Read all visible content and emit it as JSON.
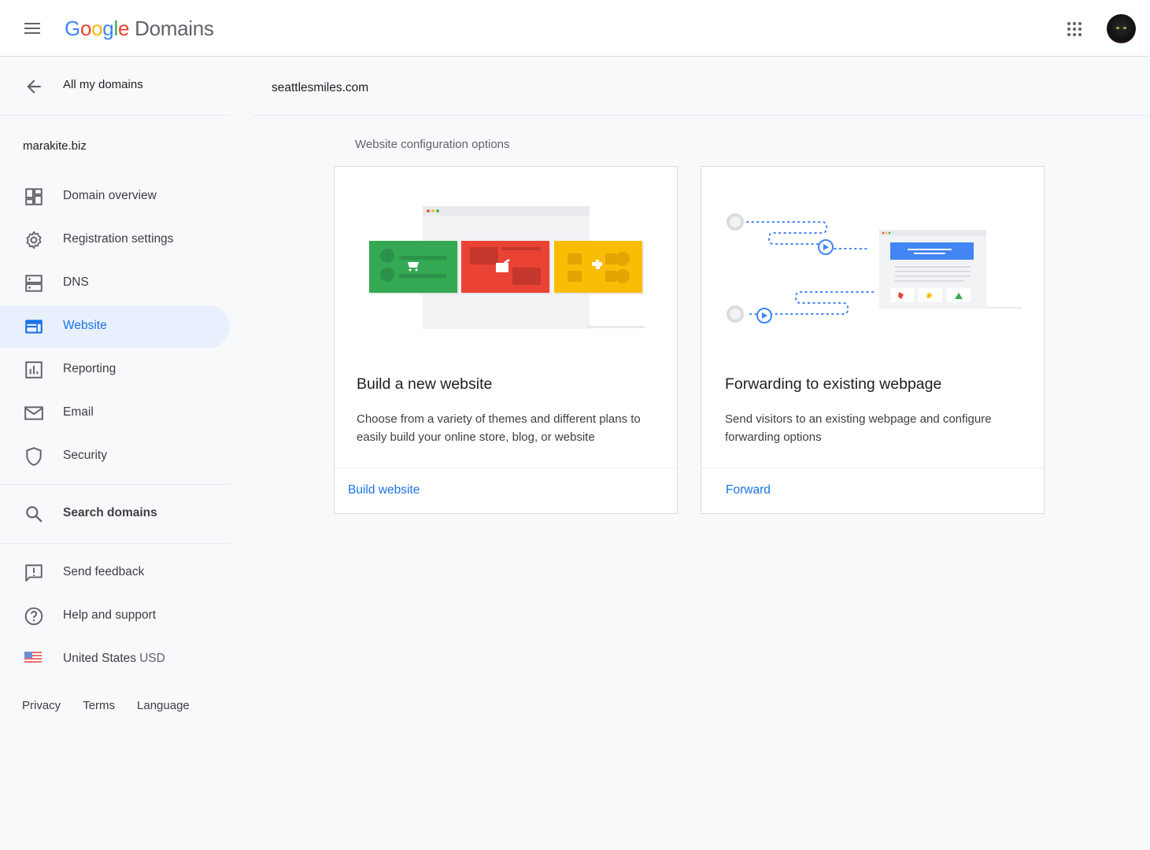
{
  "header": {
    "logo": {
      "g1": "G",
      "g2": "o",
      "g3": "o",
      "g4": "g",
      "g5": "l",
      "g6": "e",
      "product": "Domains"
    }
  },
  "sidebar": {
    "back_label": "All my domains",
    "site_name": "marakite.biz",
    "items": [
      {
        "label": "Domain overview",
        "icon": "dashboard-icon"
      },
      {
        "label": "Registration settings",
        "icon": "gear-icon"
      },
      {
        "label": "DNS",
        "icon": "dns-icon"
      },
      {
        "label": "Website",
        "icon": "website-icon",
        "active": true
      },
      {
        "label": "Reporting",
        "icon": "chart-icon"
      },
      {
        "label": "Email",
        "icon": "mail-icon"
      },
      {
        "label": "Security",
        "icon": "shield-icon"
      }
    ],
    "search_label": "Search domains",
    "feedback_label": "Send feedback",
    "help_label": "Help and support",
    "region": {
      "country": "United States",
      "currency": "USD"
    },
    "footer": {
      "privacy": "Privacy",
      "terms": "Terms",
      "language": "Language"
    }
  },
  "main": {
    "domain": "seattlesmiles.com",
    "section_title": "Website configuration options",
    "cards": [
      {
        "title": "Build a new website",
        "description": "Choose from a variety of themes and different plans to easily build your online store, blog, or website",
        "action": "Build website"
      },
      {
        "title": "Forwarding to existing webpage",
        "description": "Send visitors to an existing webpage and configure forwarding options",
        "action": "Forward"
      }
    ]
  },
  "colors": {
    "accent": "#1a73e8",
    "active_bg": "#e8f0fe",
    "green": "#34a853",
    "red": "#ea4335",
    "yellow": "#fbbc05",
    "blue": "#4285f4"
  }
}
